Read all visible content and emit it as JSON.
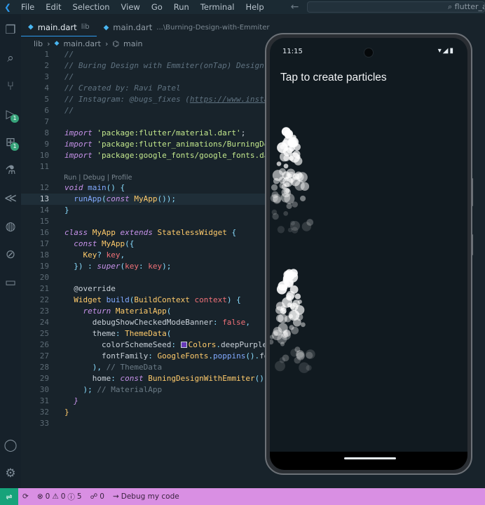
{
  "menubar": {
    "items": [
      "File",
      "Edit",
      "Selection",
      "View",
      "Go",
      "Run",
      "Terminal",
      "Help"
    ],
    "search_text": "flutter_a"
  },
  "activity": {
    "run_badge": "1",
    "extensions_badge": "1"
  },
  "tabs": [
    {
      "label": "main.dart",
      "hint": "lib",
      "active": true
    },
    {
      "label": "main.dart",
      "hint": "...\\Burning-Design-with-Emmiter",
      "active": false
    }
  ],
  "breadcrumb": {
    "folder": "lib",
    "file": "main.dart",
    "symbol": "main"
  },
  "editor": {
    "current_line": 13,
    "codelens": "Run | Debug | Profile"
  },
  "phone": {
    "time": "11:15",
    "status_icons": "▾◢▮",
    "app_title": "Tap to create particles"
  },
  "statusbar": {
    "errors": "0",
    "warnings": "0",
    "info": "5",
    "ports": "0",
    "debug_label": "Debug my code"
  },
  "colors": {
    "editor_bg": "#18232b",
    "statusbar_bg": "#d98fe3",
    "accent": "#2d9bf0"
  }
}
